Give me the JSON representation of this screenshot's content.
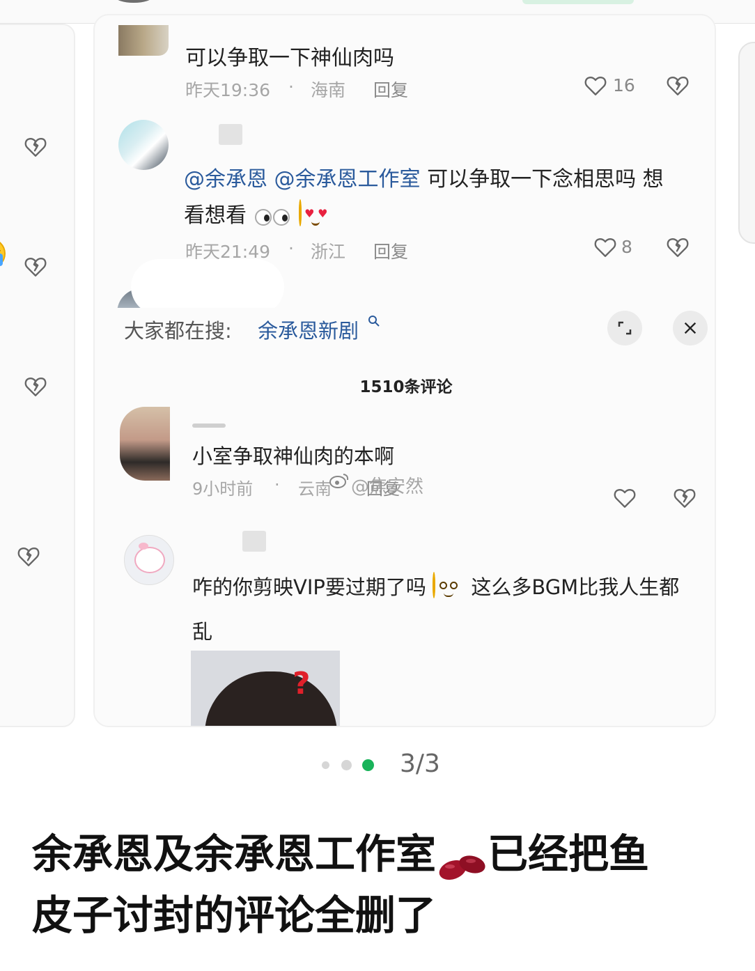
{
  "comments": [
    {
      "text": "可以争取一下神仙肉吗",
      "time": "昨天19:36",
      "location": "海南",
      "reply_label": "回复",
      "likes": "16"
    },
    {
      "mentions": [
        "@余承恩",
        "@余承恩工作室"
      ],
      "text_line1": "可以争取一下念相思吗  想",
      "text_line2": "看想看",
      "time": "昨天21:49",
      "location": "浙江",
      "reply_label": "回复",
      "likes": "8"
    }
  ],
  "search_bar": {
    "label": "大家都在搜:",
    "query": "余承恩新剧"
  },
  "comment_panel": {
    "count_label": "1510条评论",
    "comments": [
      {
        "text": "小室争取神仙肉的本啊",
        "time": "9小时前",
        "location": "云南",
        "reply_label": "回复",
        "watermark": "@焦安然"
      },
      {
        "text_line1_a": "咋的你剪映VIP要过期了吗",
        "text_line1_b": "这么多BGM比我人生都",
        "text_line2": "乱"
      }
    ]
  },
  "pager": {
    "label": "3/3",
    "total": 3,
    "current": 3
  },
  "caption": {
    "line1_a": "余承恩及余承恩工作室",
    "line1_b": "已经把鱼",
    "line2": "皮子讨封的评论全删了"
  },
  "icons": {
    "like": "heart-outline-icon",
    "dislike": "broken-heart-icon",
    "expand": "expand-icon",
    "close": "close-icon",
    "search": "search-icon"
  },
  "colors": {
    "mention": "#2a5a9c",
    "search_query": "#2a5a9c",
    "pager_active": "#19b35a",
    "meta": "#a6a6a6"
  }
}
